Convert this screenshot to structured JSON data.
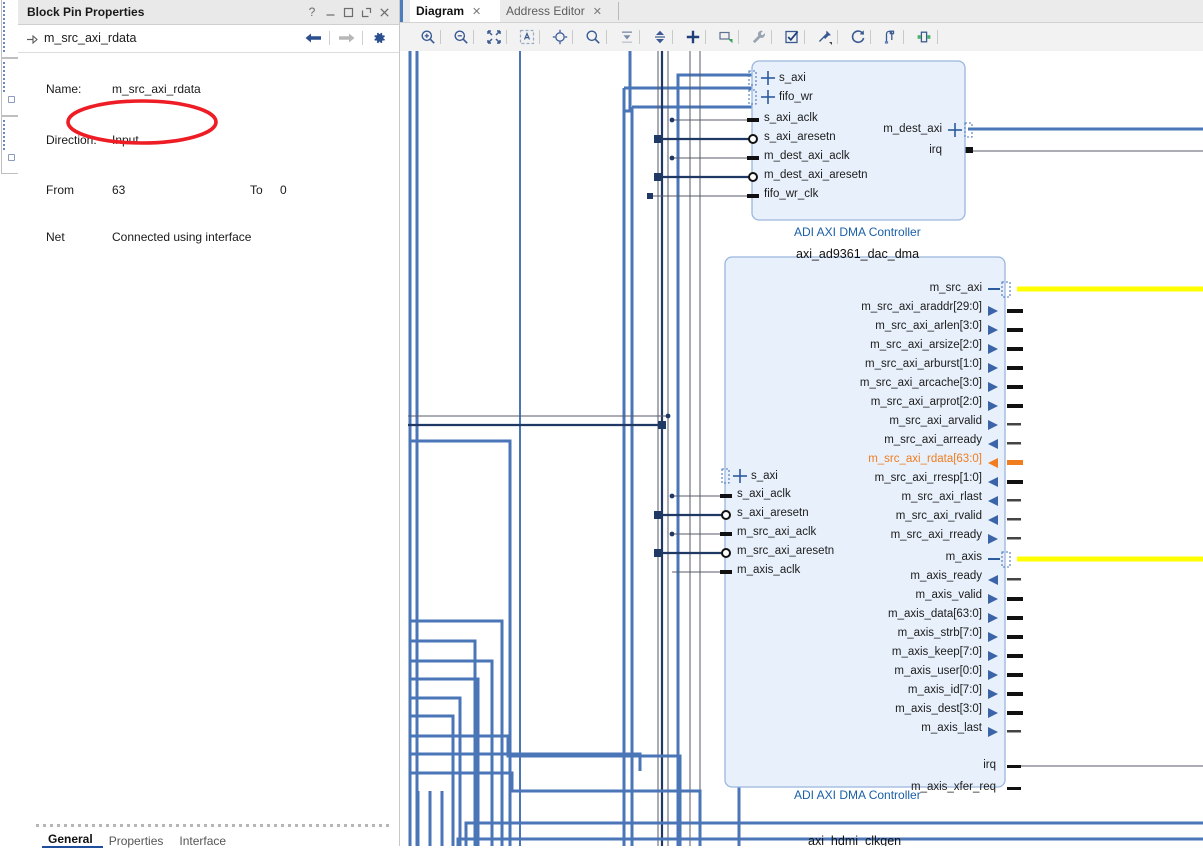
{
  "left_panel": {
    "title": "Block Pin Properties",
    "window_buttons": [
      "?",
      "minimize",
      "maximize",
      "float",
      "close"
    ],
    "pin_name": "m_src_axi_rdata",
    "nav": [
      "back-arrow",
      "forward-arrow",
      "settings-gear"
    ],
    "properties": [
      {
        "label": "Name:",
        "value": "m_src_axi_rdata"
      },
      {
        "label": "Direction:",
        "value": "Input"
      },
      {
        "label": "From",
        "value": "63",
        "label2": "To",
        "value2": "0"
      },
      {
        "label": "Net",
        "value": "Connected using interface"
      }
    ],
    "bottom_tabs": [
      {
        "label": "General",
        "selected": true
      },
      {
        "label": "Properties",
        "selected": false
      },
      {
        "label": "Interface",
        "selected": false
      }
    ],
    "annotation_color": "#ee1c25"
  },
  "tabs": [
    {
      "label": "Diagram",
      "active": true,
      "closeable": true
    },
    {
      "label": "Address Editor",
      "active": false,
      "closeable": true
    }
  ],
  "toolbar": {
    "items": [
      {
        "name": "zoom-in-icon",
        "title": "Zoom In"
      },
      {
        "name": "zoom-out-icon",
        "title": "Zoom Out"
      },
      {
        "name": "zoom-fit-icon",
        "title": "Zoom Fit"
      },
      {
        "name": "zoom-area-icon",
        "title": "Zoom Area"
      },
      {
        "name": "fit-selection-icon",
        "title": "Fit Selection"
      },
      {
        "name": "search-icon",
        "title": "Search"
      },
      {
        "name": "collapse-all-icon",
        "title": "Collapse All"
      },
      {
        "name": "expand-all-icon",
        "title": "Expand All"
      },
      {
        "name": "add-ip-icon",
        "title": "Add IP"
      },
      {
        "name": "add-module-icon",
        "title": "Add Module"
      },
      {
        "name": "run-connection-automation-icon",
        "title": "Run Connection Automation"
      },
      {
        "name": "validate-design-icon",
        "title": "Validate Design"
      },
      {
        "name": "pin-icon",
        "title": "Pin"
      },
      {
        "name": "regenerate-layout-icon",
        "title": "Regenerate Layout"
      },
      {
        "name": "optimize-routing-icon",
        "title": "Optimize Routing"
      },
      {
        "name": "highlight-icon",
        "title": "Highlight"
      }
    ]
  },
  "diagram": {
    "blocks": [
      {
        "name": "axi_ad9361_dac_dma",
        "type_label": "ADI AXI DMA Controller",
        "left_pins": [
          {
            "label": "s_axi",
            "kind": "interface"
          },
          {
            "label": "fifo_wr",
            "kind": "interface"
          },
          {
            "label": "s_axi_aclk",
            "kind": "clock"
          },
          {
            "label": "s_axi_aresetn",
            "kind": "reset"
          },
          {
            "label": "m_dest_axi_aclk",
            "kind": "clock"
          },
          {
            "label": "m_dest_axi_aresetn",
            "kind": "reset"
          },
          {
            "label": "fifo_wr_clk",
            "kind": "clock"
          }
        ],
        "right_pins": [
          {
            "label": "m_dest_axi",
            "kind": "interface"
          },
          {
            "label": "irq",
            "kind": "out"
          }
        ]
      },
      {
        "name": "",
        "type_label": "ADI AXI DMA Controller",
        "left_pins": [
          {
            "label": "s_axi",
            "kind": "interface"
          },
          {
            "label": "s_axi_aclk",
            "kind": "clock"
          },
          {
            "label": "s_axi_aresetn",
            "kind": "reset"
          },
          {
            "label": "m_src_axi_aclk",
            "kind": "clock"
          },
          {
            "label": "m_src_axi_aresetn",
            "kind": "reset"
          },
          {
            "label": "m_axis_aclk",
            "kind": "clock"
          }
        ],
        "right_pins": [
          {
            "label": "m_src_axi",
            "kind": "interface",
            "highlight": "yellow"
          },
          {
            "label": "m_src_axi_araddr[29:0]",
            "kind": "out"
          },
          {
            "label": "m_src_axi_arlen[3:0]",
            "kind": "out"
          },
          {
            "label": "m_src_axi_arsize[2:0]",
            "kind": "out"
          },
          {
            "label": "m_src_axi_arburst[1:0]",
            "kind": "out"
          },
          {
            "label": "m_src_axi_arcache[3:0]",
            "kind": "out"
          },
          {
            "label": "m_src_axi_arprot[2:0]",
            "kind": "out"
          },
          {
            "label": "m_src_axi_arvalid",
            "kind": "out"
          },
          {
            "label": "m_src_axi_arready",
            "kind": "in"
          },
          {
            "label": "m_src_axi_rdata[63:0]",
            "kind": "in",
            "highlight": "orange",
            "selected": true
          },
          {
            "label": "m_src_axi_rresp[1:0]",
            "kind": "in"
          },
          {
            "label": "m_src_axi_rlast",
            "kind": "in"
          },
          {
            "label": "m_src_axi_rvalid",
            "kind": "in"
          },
          {
            "label": "m_src_axi_rready",
            "kind": "out"
          },
          {
            "label": "m_axis",
            "kind": "interface",
            "highlight": "yellow"
          },
          {
            "label": "m_axis_ready",
            "kind": "in"
          },
          {
            "label": "m_axis_valid",
            "kind": "out"
          },
          {
            "label": "m_axis_data[63:0]",
            "kind": "out"
          },
          {
            "label": "m_axis_strb[7:0]",
            "kind": "out"
          },
          {
            "label": "m_axis_keep[7:0]",
            "kind": "out"
          },
          {
            "label": "m_axis_user[0:0]",
            "kind": "out"
          },
          {
            "label": "m_axis_id[7:0]",
            "kind": "out"
          },
          {
            "label": "m_axis_dest[3:0]",
            "kind": "out"
          },
          {
            "label": "m_axis_last",
            "kind": "out"
          },
          {
            "label": "irq",
            "kind": "out"
          },
          {
            "label": "m_axis_xfer_req",
            "kind": "out"
          }
        ]
      },
      {
        "name": "axi_hdmi_clkgen",
        "type_label": "",
        "left_pins": [],
        "right_pins": []
      }
    ],
    "colors": {
      "block_fill": "#e8f0fb",
      "block_border": "#9ab6dd",
      "interface_wire": "#4a76b8",
      "signal_wire": "#1f3864",
      "highlight_yellow": "#ffff00",
      "highlight_orange": "#f07d20",
      "label_blue": "#1a5fa8"
    }
  }
}
